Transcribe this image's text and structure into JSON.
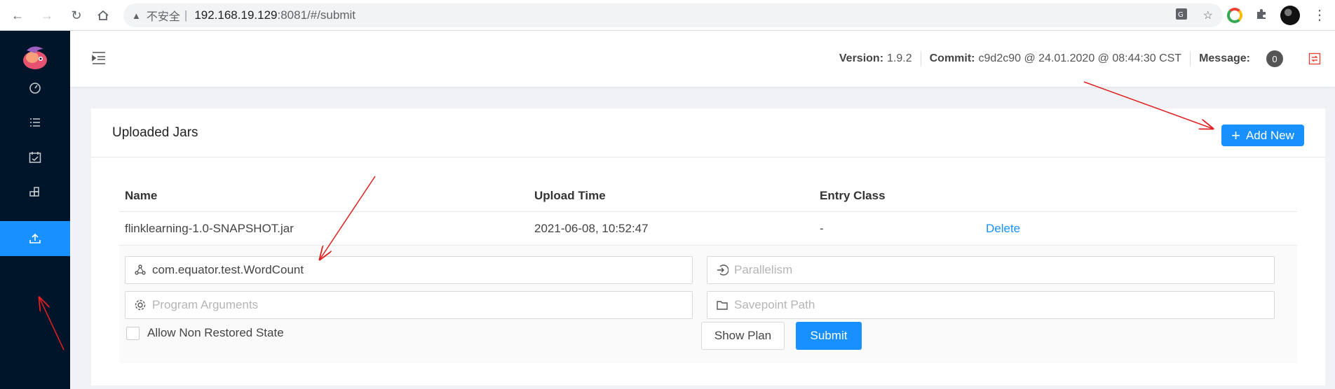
{
  "browser": {
    "security_label": "不安全",
    "separator": "|",
    "host": "192.168.19.129",
    "path": ":8081/#/submit"
  },
  "sidebar": {
    "items": [
      {
        "icon": "dashboard-icon"
      },
      {
        "icon": "list-icon"
      },
      {
        "icon": "calendar-icon"
      },
      {
        "icon": "blocks-icon"
      },
      {
        "icon": "upload-icon",
        "active": true
      }
    ]
  },
  "header": {
    "version_label": "Version:",
    "version_value": "1.9.2",
    "commit_label": "Commit:",
    "commit_value": "c9d2c90 @ 24.01.2020 @ 08:44:30 CST",
    "message_label": "Message:",
    "message_count": "0"
  },
  "card": {
    "title": "Uploaded Jars",
    "add_button": "Add New",
    "add_button_icon": "+"
  },
  "table": {
    "columns": [
      "Name",
      "Upload Time",
      "Entry Class"
    ],
    "rows": [
      {
        "name": "flinklearning-1.0-SNAPSHOT.jar",
        "upload_time": "2021-06-08, 10:52:47",
        "entry_class": "-",
        "action": "Delete"
      }
    ]
  },
  "form": {
    "entry_class_value": "com.equator.test.WordCount",
    "parallelism_placeholder": "Parallelism",
    "program_args_placeholder": "Program Arguments",
    "savepoint_placeholder": "Savepoint Path",
    "allow_non_restored_label": "Allow Non Restored State",
    "show_plan_button": "Show Plan",
    "submit_button": "Submit"
  },
  "colors": {
    "accent": "#1890ff",
    "sidebar_bg": "#001529",
    "annotation": "#e02020"
  }
}
